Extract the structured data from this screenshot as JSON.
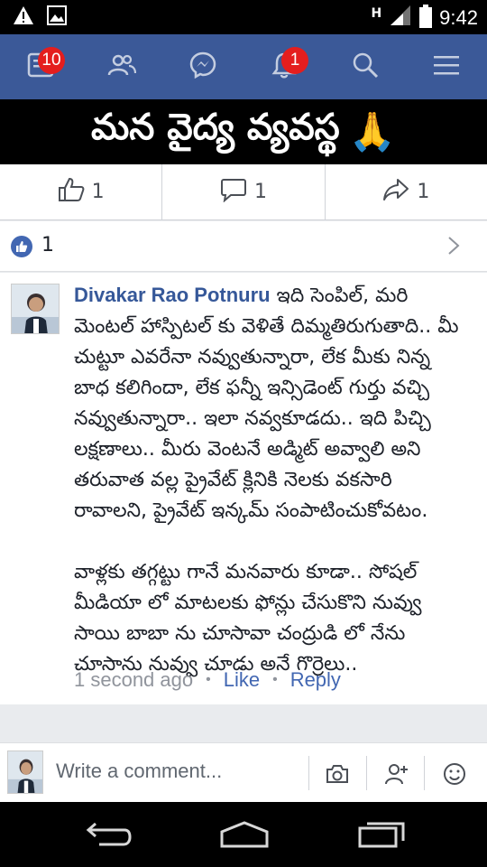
{
  "status_bar": {
    "time": "9:42",
    "network_letter": "H",
    "left_icons": [
      "warning-icon",
      "image-icon"
    ],
    "right_icons": [
      "signal-icon",
      "battery-icon"
    ]
  },
  "nav": {
    "items": [
      {
        "name": "news-feed",
        "badge": "10"
      },
      {
        "name": "friends",
        "badge": ""
      },
      {
        "name": "messenger",
        "badge": ""
      },
      {
        "name": "notifications",
        "badge": "1"
      },
      {
        "name": "search",
        "badge": ""
      },
      {
        "name": "menu",
        "badge": ""
      }
    ],
    "colors": {
      "bar": "#3b5998",
      "badge": "#e41e1e"
    }
  },
  "post": {
    "banner_text": "మన వైద్య వ్యవస్థ",
    "banner_emoji": "🙏",
    "actions": {
      "like_count": "1",
      "comment_count": "1",
      "share_count": "1"
    },
    "reactions_count": "1"
  },
  "comment": {
    "author": "Divakar Rao Potnuru",
    "text": " ఇది సెంపిల్, మరి మెంటల్ హాస్పిటల్ కు వెళితే దిమ్మతిరుగుతాది.. మీ చుట్టూ ఎవరేనా నవ్వుతున్నారా, లేక మీకు నిన్న బాధ కలిగిందా, లేక ఫన్నీ ఇన్సిడెంట్ గుర్తు వచ్చి నవ్వుతున్నారా.. ఇలా నవ్వకూడదు.. ఇది పిచ్చి లక్షణాలు.. మీరు వెంటనే అడ్మిట్ అవ్వాలి అని తరువాత వల్ల ప్రైవేట్ క్లినికి నెలకు వకసారి రావాలని, ప్రైవేట్ ఇన్కమ్ సంపాటించుకోవటం.\n\nవాళ్లకు తగ్గట్టు గానే మనవారు కూడా.. సోషల్ మీడియా లో మాటలకు ఫోన్లు చేసుకొని నువ్వు సాయి బాబా ను చూసావా చంద్రుడి లో నేను చూసాను నువ్వు చూడు అనే గొర్రెలు..",
    "time": "1 second ago",
    "separator": "•",
    "like_label": "Like",
    "reply_label": "Reply"
  },
  "composer": {
    "placeholder": "Write a comment...",
    "icons": [
      "camera-icon",
      "add-friend-icon",
      "emoji-icon"
    ]
  },
  "android_nav": {
    "icons": [
      "back-icon",
      "home-icon",
      "recents-icon"
    ]
  }
}
